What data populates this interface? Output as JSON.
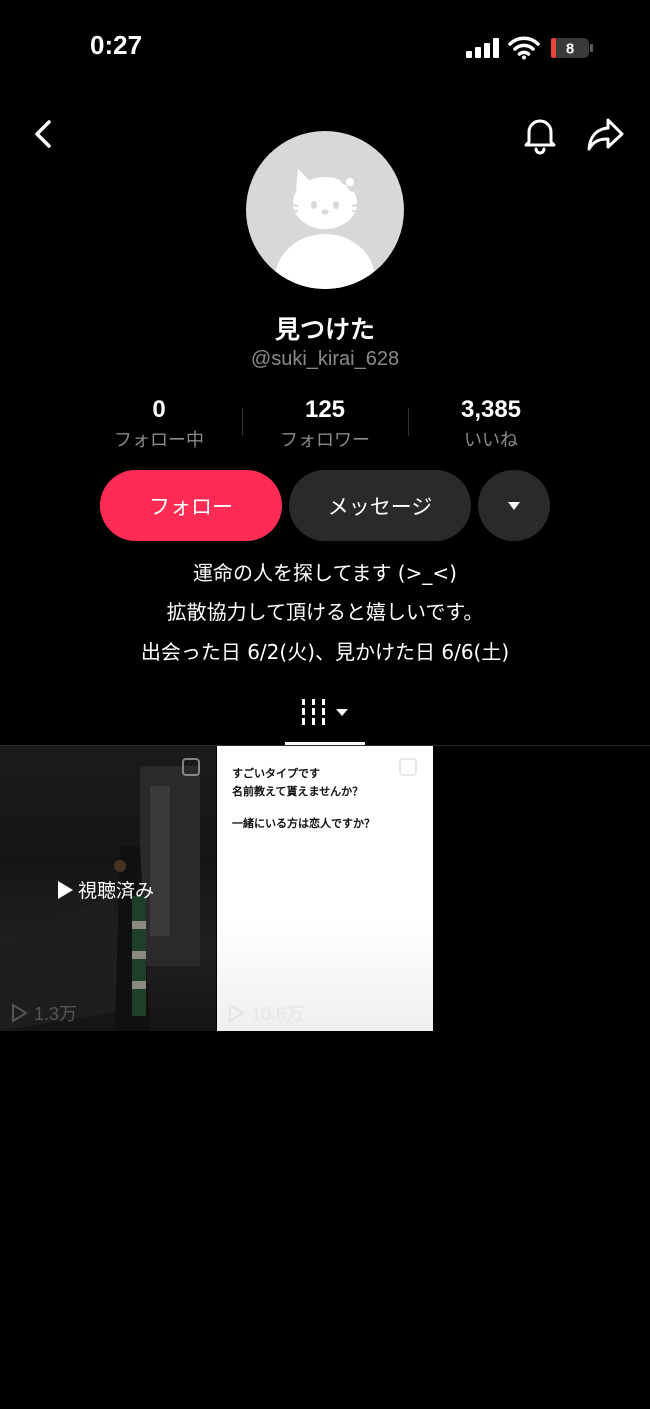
{
  "status_bar": {
    "time": "0:27",
    "battery": "8"
  },
  "profile": {
    "display_name": "見つけた",
    "handle": "@suki_kirai_628"
  },
  "stats": [
    {
      "value": "0",
      "label": "フォロー中"
    },
    {
      "value": "125",
      "label": "フォロワー"
    },
    {
      "value": "3,385",
      "label": "いいね"
    }
  ],
  "actions": {
    "follow_label": "フォロー",
    "message_label": "メッセージ"
  },
  "bio": {
    "line1": "運命の人を探してます (>_<)",
    "line2": "拡散協力して頂けると嬉しいです。",
    "line3": "出会った日 6/2(火)、見かけた日 6/6(土)"
  },
  "videos": [
    {
      "overlay": "視聴済み",
      "views": "1.3万"
    },
    {
      "text_lines": [
        "すごいタイプです",
        "名前教えて貰えませんか？",
        "一緒にいる方は恋人ですか？"
      ],
      "views": "10.6万"
    }
  ],
  "colors": {
    "accent": "#fe2c55",
    "secondary_button": "#2a2a2a",
    "muted_text": "#8a8a8a"
  },
  "icons": [
    "back-icon",
    "bell-icon",
    "share-icon",
    "dropdown-icon",
    "grid-icon",
    "play-icon"
  ]
}
